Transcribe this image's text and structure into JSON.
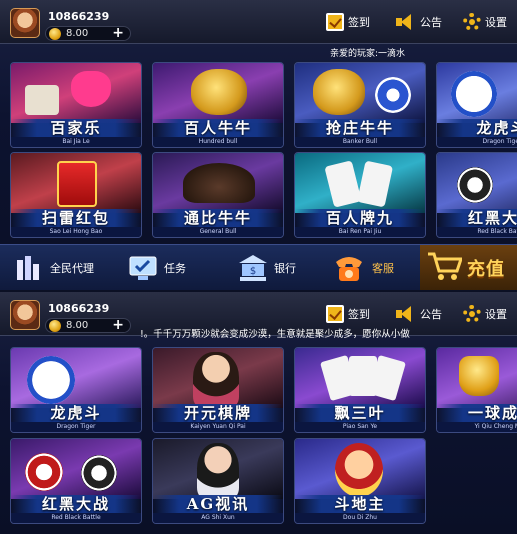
{
  "panel_a": {
    "user_id": "10866239",
    "balance": "8.00",
    "toolbar": {
      "checkin": "签到",
      "notice": "公告",
      "settings": "设置"
    },
    "marquee": "亲爱的玩家:一滴水",
    "games": [
      {
        "title": "百家乐",
        "subtitle": "Bai Jia Le"
      },
      {
        "title": "百人牛牛",
        "subtitle": "Hundred bull"
      },
      {
        "title": "抢庄牛牛",
        "subtitle": "Banker Bull"
      },
      {
        "title": "龙虎斗",
        "subtitle": "Dragon Tiger"
      },
      {
        "title": "扫雷红包",
        "subtitle": "Sao Lei Hong Bao"
      },
      {
        "title": "通比牛牛",
        "subtitle": "General Bull"
      },
      {
        "title": "百人牌九",
        "subtitle": "Bai Ren Pai Jiu"
      },
      {
        "title": "红黑大战",
        "subtitle": "Red Black Battle"
      }
    ],
    "nav": {
      "agent": "全民代理",
      "tasks": "任务",
      "bank": "银行",
      "service": "客服",
      "recharge": "充值"
    }
  },
  "panel_b": {
    "user_id": "10866239",
    "balance": "8.00",
    "toolbar": {
      "checkin": "签到",
      "notice": "公告",
      "settings": "设置"
    },
    "marquee": "!。千千万万颗沙就会变成沙漠，生意就是聚少成多，愿你从小做",
    "games": [
      {
        "title": "龙虎斗",
        "subtitle": "Dragon Tiger"
      },
      {
        "title": "开元棋牌",
        "subtitle": "Kaiyen Yuan Qi Pai"
      },
      {
        "title": "飘三叶",
        "subtitle": "Piao San Ye"
      },
      {
        "title": "一球成名",
        "subtitle": "Yi Qiu Cheng Ming"
      },
      {
        "title": "红黑大战",
        "subtitle": "Red Black Battle"
      },
      {
        "title": "AG视讯",
        "subtitle": "AG Shi Xun"
      },
      {
        "title": "斗地主",
        "subtitle": "Dou Di Zhu"
      }
    ]
  }
}
